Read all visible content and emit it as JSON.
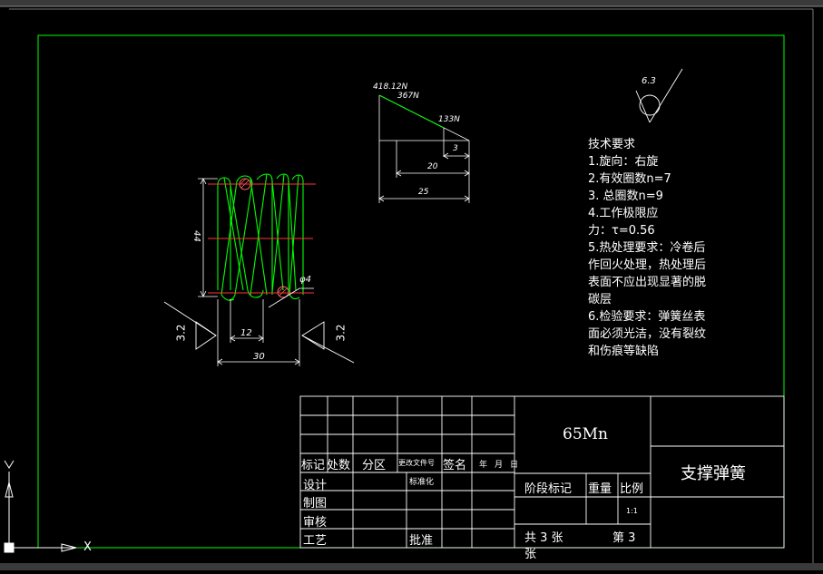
{
  "drawing": {
    "tech_title": "技术要求",
    "tech_lines": [
      "1.旋向：右旋",
      "2.有效圈数n=7",
      "3.  总圈数n=9",
      "4.工作极限应",
      "力：τ=0.56",
      "5.热处理要求：冷卷后",
      "作回火处理，热处理后",
      "表面不应出现显著的脱",
      "碳层",
      "6.检验要求：弹簧丝表",
      "面必须光洁，没有裂纹",
      "和伤痕等缺陷"
    ],
    "roughness": "6.3",
    "spring_dims": {
      "height": "44",
      "wire_dia": "φ4",
      "pitch": "12",
      "outer": "30",
      "flatness_left": "3.2",
      "flatness_right": "3.2"
    },
    "load_diagram": {
      "f1": "418.12N",
      "f2": "367N",
      "f3": "133N",
      "d1": "3",
      "d2": "20",
      "d3": "25"
    }
  },
  "title_block": {
    "material": "65Mn",
    "part_name": "支撑弹簧",
    "headers": [
      "标记",
      "处数",
      "分区",
      "更改文件号",
      "签名",
      "年",
      "月",
      "日"
    ],
    "roles": [
      "设计",
      "制图",
      "审核",
      "工艺"
    ],
    "standardize": "标准化",
    "approve": "批准",
    "stage_mark": "阶段标记",
    "weight": "重量",
    "scale_label": "比例",
    "scale_value": "1:1",
    "sheets_total": "共 3 张",
    "sheet_no": "第 3",
    "sheet_unit": "张"
  },
  "ucs": {
    "x_label": "X",
    "y_label": "Y"
  }
}
